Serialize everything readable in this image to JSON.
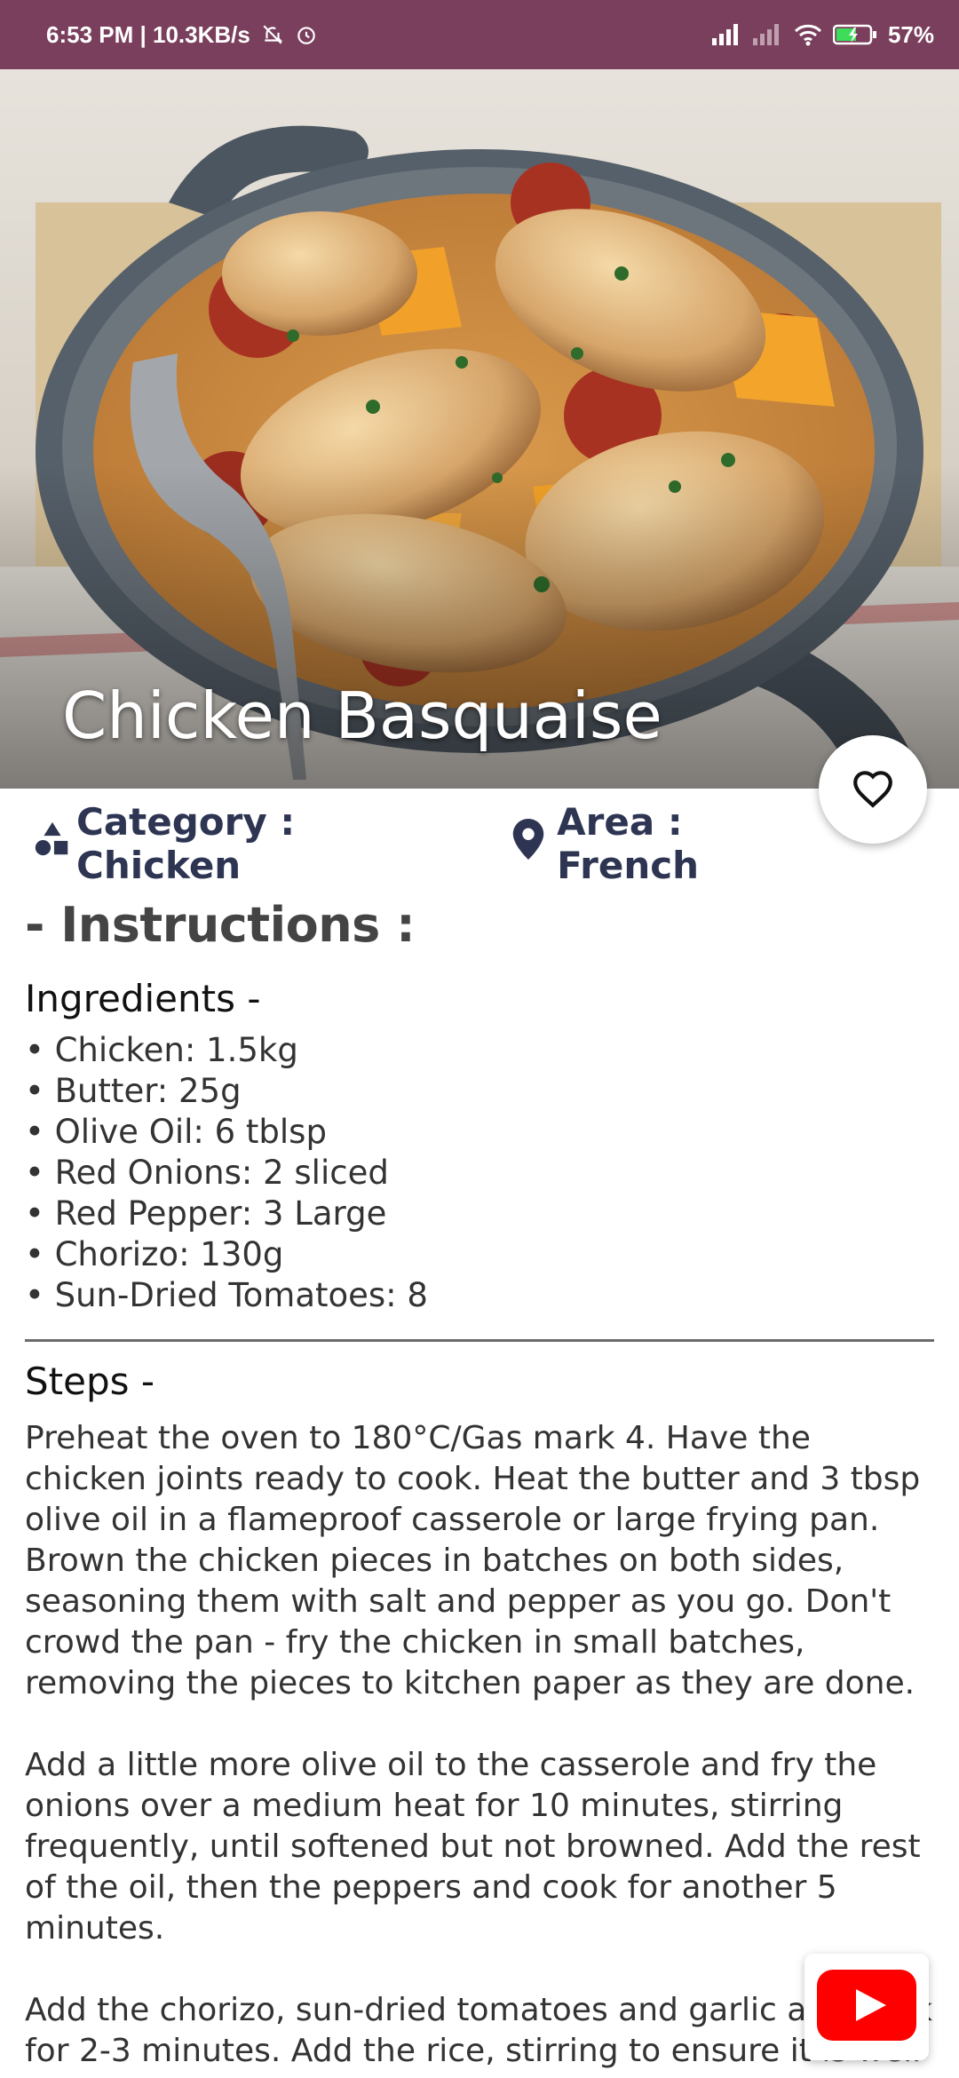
{
  "status_bar": {
    "time_info": "6:53 PM | 10.3KB/s",
    "battery": "57%"
  },
  "recipe": {
    "title": "Chicken Basquaise",
    "category": "Category : Chicken",
    "area": "Area : French",
    "instructions_title": "- Instructions :",
    "ingredients_heading": "Ingredients -",
    "ingredients": [
      "Chicken: 1.5kg",
      "Butter: 25g",
      "Olive Oil: 6 tblsp",
      "Red Onions: 2 sliced",
      "Red Pepper: 3 Large",
      "Chorizo: 130g",
      "Sun-Dried Tomatoes: 8"
    ],
    "steps_heading": "Steps -",
    "steps_text": "Preheat the oven to 180°C/Gas mark 4. Have the chicken joints ready to cook. Heat the butter and 3 tbsp olive oil in a flameproof casserole or large frying pan. Brown the chicken pieces in batches on both sides, seasoning them with salt and pepper as you go. Don't crowd the pan - fry the chicken in small batches, removing the pieces to kitchen paper as they are done.\n\nAdd a little more olive oil to the casserole and fry the onions over a medium heat for 10 minutes, stirring frequently, until softened but not browned. Add the rest of the oil, then the peppers and cook for another 5 minutes.\n\nAdd the chorizo, sun-dried tomatoes and garlic and cook for 2-3 minutes. Add the rice, stirring to ensure it is well coated in the oil. Stir in the tomato paste, paprika, bay"
  },
  "icons": {
    "favorite": "heart-outline-icon",
    "category": "shapes-icon",
    "area": "location-pin-icon",
    "video": "youtube-play-icon"
  },
  "colors": {
    "status_bar": "#7a3f5c",
    "meta_text": "#2e3553",
    "youtube_red": "#ff0000"
  }
}
